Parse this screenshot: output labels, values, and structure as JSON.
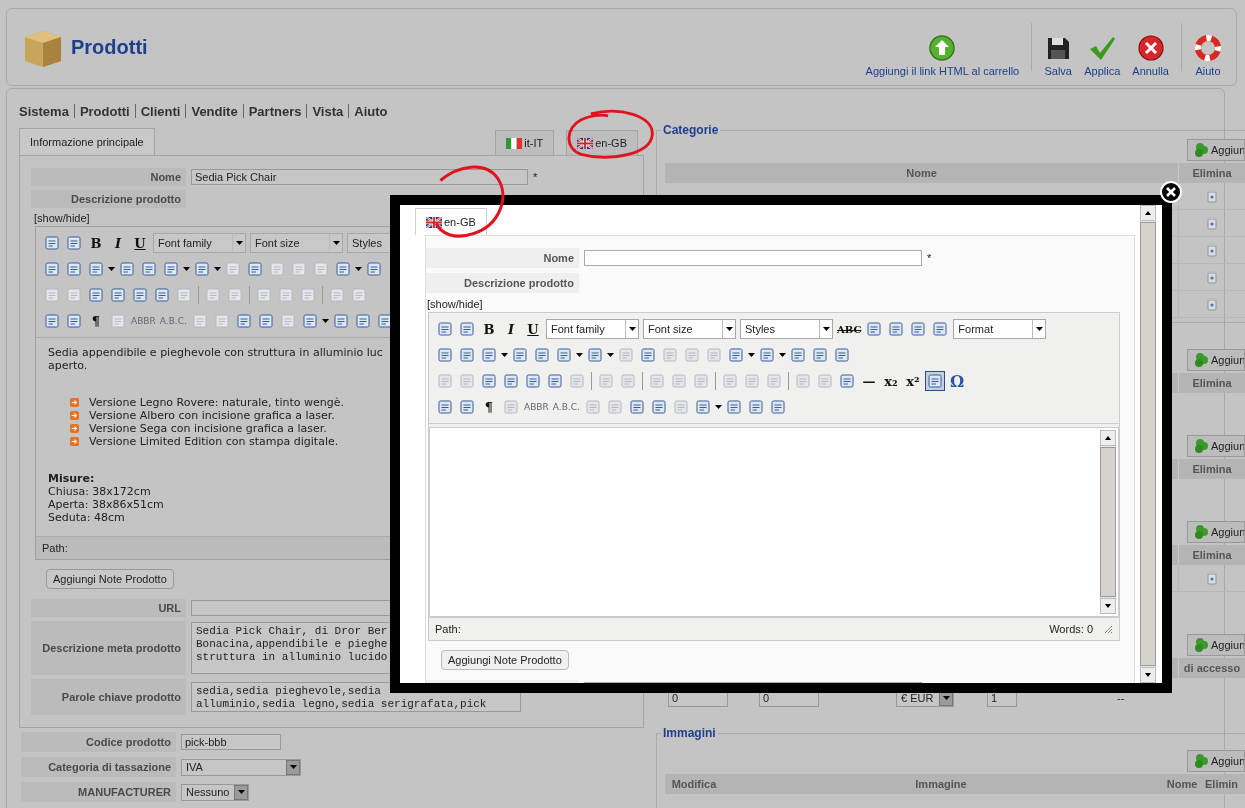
{
  "header": {
    "title": "Prodotti",
    "actions": [
      {
        "kind": "add-link",
        "label": "Aggiungi il link HTML al carrello"
      },
      {
        "kind": "save",
        "label": "Salva"
      },
      {
        "kind": "apply",
        "label": "Applica"
      },
      {
        "kind": "cancel",
        "label": "Annulla"
      },
      {
        "kind": "help",
        "label": "Aiuto"
      }
    ]
  },
  "menu": [
    "Sistema",
    "Prodotti",
    "Clienti",
    "Vendite",
    "Partners",
    "Vista",
    "Aiuto"
  ],
  "left_tabs": [
    {
      "label": "Informazione principale",
      "selected": true
    }
  ],
  "language_tabs": [
    {
      "label": "it-IT",
      "kind": "it",
      "selected": false
    },
    {
      "label": "en-GB",
      "kind": "gb",
      "selected": false
    }
  ],
  "form": {
    "name_label": "Nome",
    "name_value": "Sedia Pick Chair",
    "required_mark": "*",
    "description_label": "Descrizione prodotto",
    "toggle": "[show/hide]",
    "toolbar": [
      [
        {
          "kind": "icon",
          "disabled": false,
          "active": false
        },
        {
          "kind": "icon",
          "disabled": false,
          "active": false
        },
        {
          "kind": "bold",
          "label": "B",
          "disabled": false,
          "active": false
        },
        {
          "kind": "italic",
          "label": "I",
          "disabled": false,
          "active": false
        },
        {
          "kind": "underline",
          "label": "U",
          "disabled": false,
          "active": false
        },
        {
          "kind": "select",
          "label": "Font family"
        },
        {
          "kind": "select",
          "label": "Font size"
        },
        {
          "kind": "select",
          "label": "Styles"
        }
      ],
      [
        {
          "kind": "icon",
          "disabled": false,
          "active": false
        },
        {
          "kind": "icon",
          "disabled": false,
          "active": false
        },
        {
          "kind": "icon",
          "disabled": false,
          "active": false
        },
        {
          "kind": "caret"
        },
        {
          "kind": "icon",
          "disabled": false,
          "active": false
        },
        {
          "kind": "icon",
          "disabled": false,
          "active": false
        },
        {
          "kind": "icon",
          "disabled": false,
          "active": false
        },
        {
          "kind": "caret"
        },
        {
          "kind": "icon",
          "disabled": false,
          "active": false
        },
        {
          "kind": "caret"
        },
        {
          "kind": "icon",
          "disabled": true,
          "active": false
        },
        {
          "kind": "icon",
          "disabled": false,
          "active": false
        },
        {
          "kind": "icon",
          "disabled": true,
          "active": false
        },
        {
          "kind": "icon",
          "disabled": true,
          "active": false
        },
        {
          "kind": "icon",
          "disabled": true,
          "active": false
        },
        {
          "kind": "icon",
          "disabled": false,
          "active": false
        },
        {
          "kind": "caret"
        },
        {
          "kind": "icon",
          "disabled": false,
          "active": false
        }
      ],
      [
        {
          "kind": "icon",
          "disabled": true,
          "active": false
        },
        {
          "kind": "icon",
          "disabled": true,
          "active": false
        },
        {
          "kind": "icon",
          "disabled": false,
          "active": false
        },
        {
          "kind": "icon",
          "disabled": false,
          "active": false
        },
        {
          "kind": "icon",
          "disabled": false,
          "active": false
        },
        {
          "kind": "icon",
          "disabled": false,
          "active": false
        },
        {
          "kind": "icon",
          "disabled": true,
          "active": false
        },
        {
          "kind": "sep"
        },
        {
          "kind": "icon",
          "disabled": true,
          "active": false
        },
        {
          "kind": "icon",
          "disabled": true,
          "active": false
        },
        {
          "kind": "sep"
        },
        {
          "kind": "icon",
          "disabled": true,
          "active": false
        },
        {
          "kind": "icon",
          "disabled": true,
          "active": false
        },
        {
          "kind": "icon",
          "disabled": true,
          "active": false
        },
        {
          "kind": "sep"
        },
        {
          "kind": "icon",
          "disabled": true,
          "active": false
        },
        {
          "kind": "icon",
          "disabled": true,
          "active": false
        }
      ],
      [
        {
          "kind": "icon",
          "disabled": false,
          "active": false
        },
        {
          "kind": "icon",
          "disabled": false,
          "active": false
        },
        {
          "kind": "glyph",
          "label": "¶",
          "disabled": false,
          "active": false
        },
        {
          "kind": "icon",
          "disabled": true,
          "active": false
        },
        {
          "kind": "small",
          "label": "ABBR",
          "disabled": true,
          "active": false
        },
        {
          "kind": "small",
          "label": "A.B.C.",
          "disabled": true,
          "active": false
        },
        {
          "kind": "icon",
          "disabled": true,
          "active": false
        },
        {
          "kind": "icon",
          "disabled": true,
          "active": false
        },
        {
          "kind": "icon",
          "disabled": false,
          "active": false
        },
        {
          "kind": "icon",
          "disabled": false,
          "active": false
        },
        {
          "kind": "icon",
          "disabled": true,
          "active": false
        },
        {
          "kind": "icon",
          "disabled": false,
          "active": false
        },
        {
          "kind": "caret"
        },
        {
          "kind": "icon",
          "disabled": false,
          "active": false
        },
        {
          "kind": "icon",
          "disabled": false,
          "active": false
        },
        {
          "kind": "icon",
          "disabled": false,
          "active": false
        }
      ]
    ],
    "content": [
      {
        "kind": "para",
        "text": "Sedia appendibile e pieghevole con struttura in alluminio luc"
      },
      {
        "kind": "para",
        "text": "aperto."
      },
      {
        "kind": "gap"
      },
      {
        "kind": "bullet",
        "text": "Versione Legno Rovere: naturale, tinto wengè."
      },
      {
        "kind": "bullet",
        "text": "Versione Albero con incisione grafica a laser."
      },
      {
        "kind": "bullet",
        "text": "Versione Sega con incisione grafica a laser."
      },
      {
        "kind": "bullet",
        "text": "Versione Limited Edition con stampa digitale."
      },
      {
        "kind": "gap"
      },
      {
        "kind": "heading",
        "text": "Misure:"
      },
      {
        "kind": "para",
        "text": "Chiusa: 38x172cm"
      },
      {
        "kind": "para",
        "text": "Aperta: 38x86x51cm"
      },
      {
        "kind": "para",
        "text": "Seduta: 48cm"
      }
    ],
    "path_label": "Path:",
    "notes_button": "Aggiungi Note Prodotto",
    "url_label": "URL",
    "meta_label": "Descrizione meta prodotto",
    "meta_lines": [
      "Sedia Pick Chair, di Dror Ber",
      "Bonacina,appendibile e pieghe",
      "struttura in alluminio lucido"
    ],
    "keywords_label": "Parole chiave prodotto",
    "keywords_lines": [
      "sedia,sedia pieghevole,sedia",
      "alluminio,sedia legno,sedia serigrafata,pick"
    ]
  },
  "extra_fields": [
    {
      "kind": "input",
      "label": "Codice prodotto",
      "value": "pick-bbb"
    },
    {
      "kind": "select",
      "label": "Categoria di tassazione",
      "value": "IVA"
    },
    {
      "kind": "select-small",
      "label": "MANUFACTURER",
      "value": "Nessuno"
    }
  ],
  "categories": {
    "legend": "Categorie",
    "add_button": "Aggiun",
    "columns": [
      "Nome",
      "Elimina"
    ],
    "rows": [
      {
        "deletable": true
      },
      {
        "deletable": true
      },
      {
        "deletable": true
      },
      {
        "deletable": true
      },
      {
        "deletable": true
      }
    ]
  },
  "sections": [
    {
      "add_button": "Aggiun",
      "column": "Elimina"
    },
    {
      "add_button": "Aggiun",
      "column": "Elimina"
    },
    {
      "add_button": "Aggiun",
      "column": "Elimina",
      "rows": [
        {
          "deletable": true
        }
      ]
    },
    {
      "add_button": "Aggiun",
      "column": "di accesso"
    }
  ],
  "price_row": {
    "fields": [
      "0",
      "0"
    ],
    "currency": "€ EUR",
    "quantity": "1",
    "note": "--"
  },
  "images": {
    "legend": "Immagini",
    "add_button": "Aggiun",
    "columns": [
      "Modifica",
      "Immagine",
      "Nome",
      "Elimin"
    ]
  },
  "modal": {
    "tab": {
      "label": "en-GB",
      "kind": "gb",
      "selected": true
    },
    "name_label": "Nome",
    "required_mark": "*",
    "description_label": "Descrizione prodotto",
    "toggle": "[show/hide]",
    "toolbar": [
      [
        {
          "kind": "icon",
          "disabled": false,
          "active": false
        },
        {
          "kind": "icon",
          "disabled": false,
          "active": false
        },
        {
          "kind": "bold",
          "label": "B",
          "disabled": false,
          "active": false
        },
        {
          "kind": "italic",
          "label": "I",
          "disabled": false,
          "active": false
        },
        {
          "kind": "underline",
          "label": "U",
          "disabled": false,
          "active": false
        },
        {
          "kind": "select",
          "label": "Font family"
        },
        {
          "kind": "select",
          "label": "Font size"
        },
        {
          "kind": "select",
          "label": "Styles"
        },
        {
          "kind": "strike",
          "label": "ABC",
          "disabled": false,
          "active": false
        },
        {
          "kind": "icon",
          "disabled": false,
          "active": false
        },
        {
          "kind": "icon",
          "disabled": false,
          "active": false
        },
        {
          "kind": "icon",
          "disabled": false,
          "active": false
        },
        {
          "kind": "icon",
          "disabled": false,
          "active": false
        },
        {
          "kind": "select",
          "label": "Format"
        }
      ],
      [
        {
          "kind": "icon",
          "disabled": false,
          "active": false
        },
        {
          "kind": "icon",
          "disabled": false,
          "active": false
        },
        {
          "kind": "icon",
          "disabled": false,
          "active": false
        },
        {
          "kind": "caret"
        },
        {
          "kind": "icon",
          "disabled": false,
          "active": false
        },
        {
          "kind": "icon",
          "disabled": false,
          "active": false
        },
        {
          "kind": "icon",
          "disabled": false,
          "active": false
        },
        {
          "kind": "caret"
        },
        {
          "kind": "icon",
          "disabled": false,
          "active": false
        },
        {
          "kind": "caret"
        },
        {
          "kind": "icon",
          "disabled": true,
          "active": false
        },
        {
          "kind": "icon",
          "disabled": false,
          "active": false
        },
        {
          "kind": "icon",
          "disabled": true,
          "active": false
        },
        {
          "kind": "icon",
          "disabled": true,
          "active": false
        },
        {
          "kind": "icon",
          "disabled": true,
          "active": false
        },
        {
          "kind": "icon",
          "disabled": false,
          "active": false
        },
        {
          "kind": "caret"
        },
        {
          "kind": "icon",
          "disabled": false,
          "active": false
        },
        {
          "kind": "caret"
        },
        {
          "kind": "icon",
          "disabled": false,
          "active": false
        },
        {
          "kind": "icon",
          "disabled": false,
          "active": false
        },
        {
          "kind": "icon",
          "disabled": false,
          "active": false
        }
      ],
      [
        {
          "kind": "icon",
          "disabled": true,
          "active": false
        },
        {
          "kind": "icon",
          "disabled": true,
          "active": false
        },
        {
          "kind": "icon",
          "disabled": false,
          "active": false
        },
        {
          "kind": "icon",
          "disabled": false,
          "active": false
        },
        {
          "kind": "icon",
          "disabled": false,
          "active": false
        },
        {
          "kind": "icon",
          "disabled": false,
          "active": false
        },
        {
          "kind": "icon",
          "disabled": true,
          "active": false
        },
        {
          "kind": "sep"
        },
        {
          "kind": "icon",
          "disabled": true,
          "active": false
        },
        {
          "kind": "icon",
          "disabled": true,
          "active": false
        },
        {
          "kind": "sep"
        },
        {
          "kind": "icon",
          "disabled": true,
          "active": false
        },
        {
          "kind": "icon",
          "disabled": true,
          "active": false
        },
        {
          "kind": "icon",
          "disabled": true,
          "active": false
        },
        {
          "kind": "sep"
        },
        {
          "kind": "icon",
          "disabled": true,
          "active": false
        },
        {
          "kind": "icon",
          "disabled": true,
          "active": false
        },
        {
          "kind": "icon",
          "disabled": true,
          "active": false
        },
        {
          "kind": "sep"
        },
        {
          "kind": "icon",
          "disabled": true,
          "active": false
        },
        {
          "kind": "icon",
          "disabled": true,
          "active": false
        },
        {
          "kind": "icon",
          "disabled": false,
          "active": false
        },
        {
          "kind": "glyph",
          "label": "—",
          "disabled": false,
          "active": false
        },
        {
          "kind": "bold",
          "label": "x₂",
          "disabled": false,
          "active": false
        },
        {
          "kind": "bold",
          "label": "x²",
          "disabled": false,
          "active": false
        },
        {
          "kind": "icon",
          "disabled": false,
          "active": true
        },
        {
          "kind": "symbol",
          "label": "Ω",
          "disabled": false,
          "active": false
        }
      ],
      [
        {
          "kind": "icon",
          "disabled": false,
          "active": false
        },
        {
          "kind": "icon",
          "disabled": false,
          "active": false
        },
        {
          "kind": "glyph",
          "label": "¶",
          "disabled": false,
          "active": false
        },
        {
          "kind": "icon",
          "disabled": true,
          "active": false
        },
        {
          "kind": "small",
          "label": "ABBR",
          "disabled": true,
          "active": false
        },
        {
          "kind": "small",
          "label": "A.B.C.",
          "disabled": true,
          "active": false
        },
        {
          "kind": "icon",
          "disabled": true,
          "active": false
        },
        {
          "kind": "icon",
          "disabled": true,
          "active": false
        },
        {
          "kind": "icon",
          "disabled": false,
          "active": false
        },
        {
          "kind": "icon",
          "disabled": false,
          "active": false
        },
        {
          "kind": "icon",
          "disabled": true,
          "active": false
        },
        {
          "kind": "icon",
          "disabled": false,
          "active": false
        },
        {
          "kind": "caret"
        },
        {
          "kind": "icon",
          "disabled": false,
          "active": false
        },
        {
          "kind": "icon",
          "disabled": false,
          "active": false
        },
        {
          "kind": "icon",
          "disabled": false,
          "active": false
        }
      ]
    ],
    "path_label": "Path:",
    "words": "Words: 0",
    "notes_button": "Aggiungi Note Prodotto"
  }
}
